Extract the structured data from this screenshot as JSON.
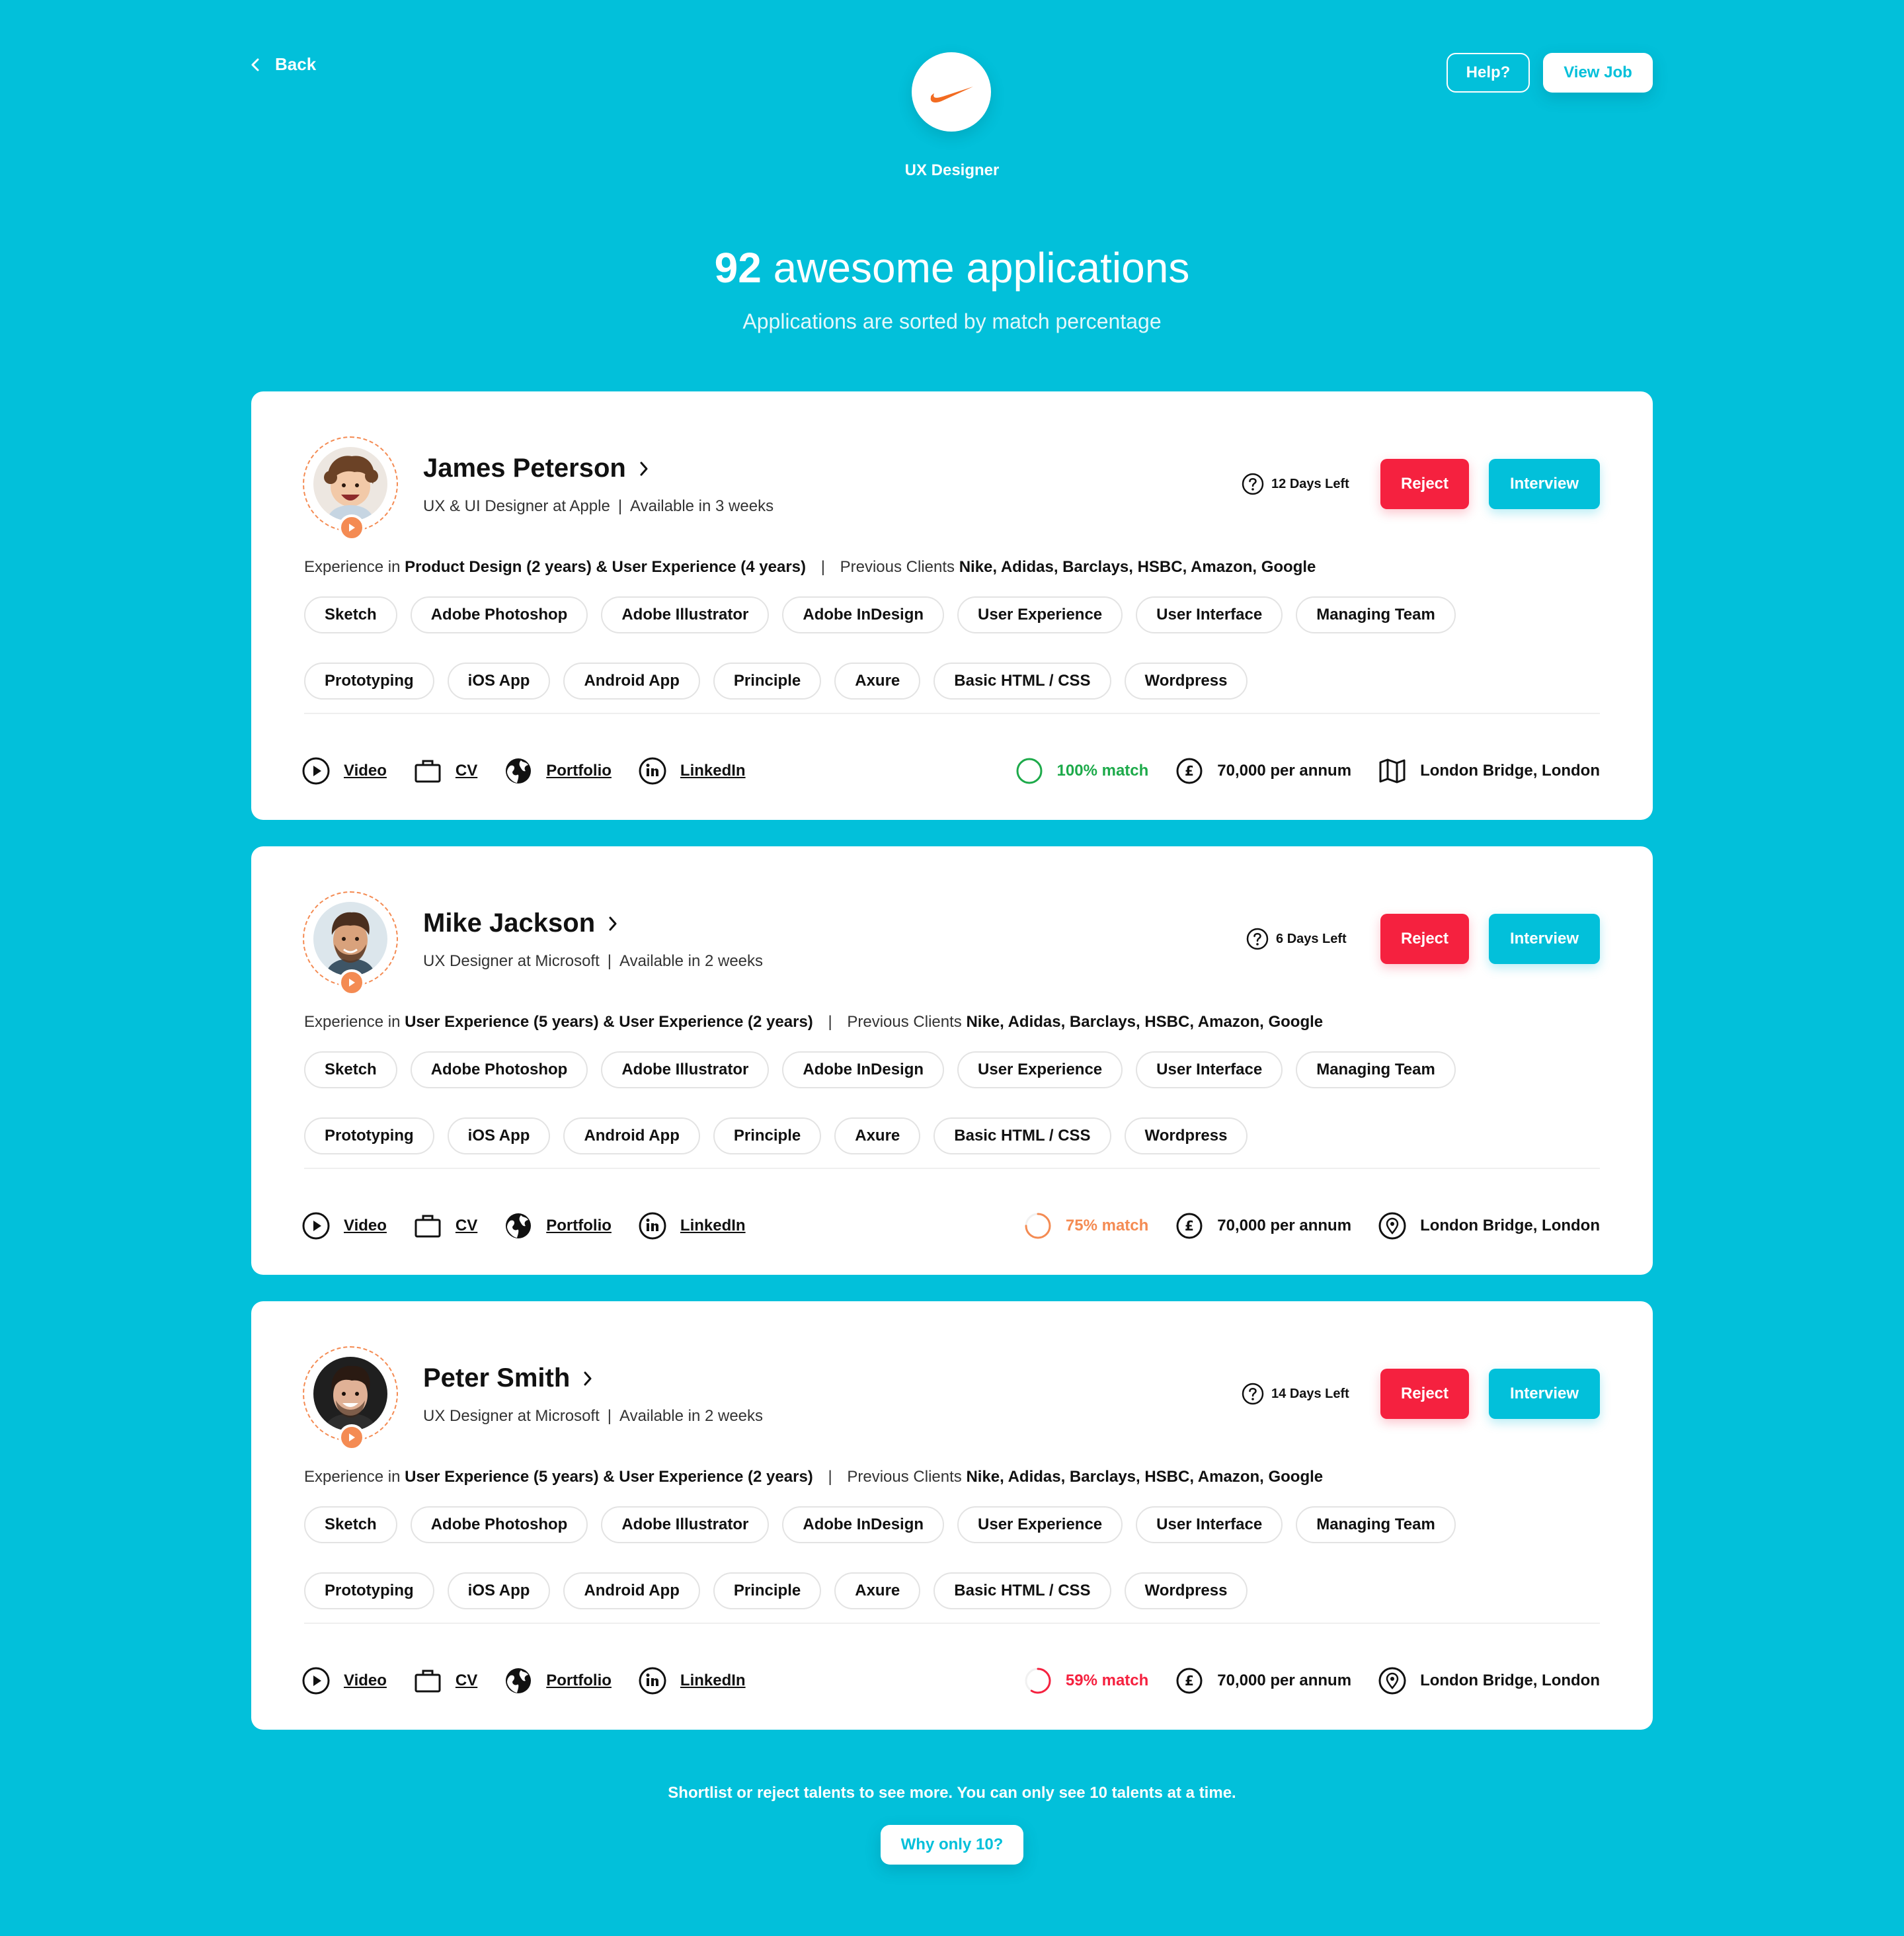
{
  "header": {
    "back_label": "Back",
    "job_title": "UX Designer",
    "help_label": "Help?",
    "view_job_label": "View Job",
    "headline_count": "92",
    "headline_text": "awesome applications",
    "subheadline": "Applications are sorted by match percentage"
  },
  "colors": {
    "background": "#02C0DA",
    "reject": "#F5213F",
    "accent_orange": "#F48B53",
    "match_green": "#1DAA4A",
    "match_orange": "#F48B53",
    "match_red": "#F5213F"
  },
  "labels": {
    "experience_prefix": "Experience in",
    "clients_prefix": "Previous Clients",
    "reject": "Reject",
    "interview": "Interview",
    "video": "Video",
    "cv": "CV",
    "portfolio": "Portfolio",
    "linkedin": "LinkedIn",
    "days_left_suffix": "Days Left"
  },
  "applicants": [
    {
      "name": "James Peterson",
      "role": "UX & UI Designer at Apple",
      "availability": "Available in 3 weeks",
      "days_left": "12",
      "experience": "Product Design (2 years) & User Experience (4 years)",
      "clients": "Nike, Adidas, Barclays, HSBC, Amazon, Google",
      "skills": [
        "Sketch",
        "Adobe Photoshop",
        "Adobe Illustrator",
        "Adobe InDesign",
        "User Experience",
        "User Interface",
        "Managing Team",
        "Prototyping",
        "iOS App",
        "Android App",
        "Principle",
        "Axure",
        "Basic HTML / CSS",
        "Wordpress"
      ],
      "match": "100% match",
      "match_percent": 100,
      "salary": "70,000 per annum",
      "location": "London Bridge, London",
      "location_icon": "map-icon"
    },
    {
      "name": "Mike Jackson",
      "role": "UX Designer at Microsoft",
      "availability": "Available in 2 weeks",
      "days_left": "6",
      "experience": "User Experience (5 years) & User Experience (2 years)",
      "clients": "Nike, Adidas, Barclays, HSBC, Amazon, Google",
      "skills": [
        "Sketch",
        "Adobe Photoshop",
        "Adobe Illustrator",
        "Adobe InDesign",
        "User Experience",
        "User Interface",
        "Managing Team",
        "Prototyping",
        "iOS App",
        "Android App",
        "Principle",
        "Axure",
        "Basic HTML / CSS",
        "Wordpress"
      ],
      "match": "75% match",
      "match_percent": 75,
      "salary": "70,000 per annum",
      "location": "London Bridge, London",
      "location_icon": "location-pin-icon"
    },
    {
      "name": "Peter Smith",
      "role": "UX Designer at Microsoft",
      "availability": "Available in 2 weeks",
      "days_left": "14",
      "experience": "User Experience (5 years) & User Experience (2 years)",
      "clients": "Nike, Adidas, Barclays, HSBC, Amazon, Google",
      "skills": [
        "Sketch",
        "Adobe Photoshop",
        "Adobe Illustrator",
        "Adobe InDesign",
        "User Experience",
        "User Interface",
        "Managing Team",
        "Prototyping",
        "iOS App",
        "Android App",
        "Principle",
        "Axure",
        "Basic HTML / CSS",
        "Wordpress"
      ],
      "match": "59% match",
      "match_percent": 59,
      "salary": "70,000 per annum",
      "location": "London Bridge, London",
      "location_icon": "location-pin-icon"
    }
  ],
  "footer": {
    "note": "Shortlist or reject talents to see more. You can only see 10 talents at a time.",
    "why_label": "Why only 10?"
  }
}
